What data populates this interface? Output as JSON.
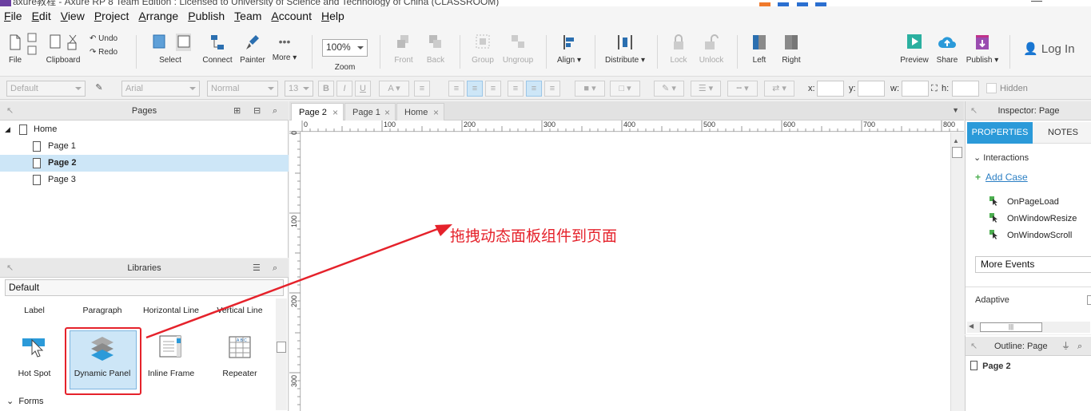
{
  "window": {
    "title": "axure教程 - Axure RP 8 Team Edition : Licensed to University of Science and Technology of China (CLASSROOM)",
    "window_controls": "—"
  },
  "menu": [
    "File",
    "Edit",
    "View",
    "Project",
    "Arrange",
    "Publish",
    "Team",
    "Account",
    "Help"
  ],
  "toolbar": {
    "file": "File",
    "clipboard": "Clipboard",
    "undo": "Undo",
    "redo": "Redo",
    "select": "Select",
    "connect": "Connect",
    "painter": "Painter",
    "more": "More ▾",
    "zoom_value": "100%",
    "zoom": "Zoom",
    "front": "Front",
    "back": "Back",
    "group": "Group",
    "ungroup": "Ungroup",
    "align": "Align ▾",
    "distribute": "Distribute ▾",
    "lock": "Lock",
    "unlock": "Unlock",
    "left": "Left",
    "right": "Right",
    "preview": "Preview",
    "share": "Share",
    "publish": "Publish ▾",
    "login": "Log In"
  },
  "format": {
    "style": "Default",
    "font": "Arial",
    "weight": "Normal",
    "size": "13",
    "bold": "B",
    "italic": "I",
    "underline": "U",
    "x_label": "x:",
    "y_label": "y:",
    "w_label": "w:",
    "h_label": "h:",
    "hidden": "Hidden"
  },
  "pages": {
    "title": "Pages",
    "items": [
      {
        "label": "Home"
      },
      {
        "label": "Page 1"
      },
      {
        "label": "Page 2"
      },
      {
        "label": "Page 3"
      }
    ]
  },
  "libraries": {
    "title": "Libraries",
    "selected": "Default",
    "row1": [
      "Label",
      "Paragraph",
      "Horizontal Line",
      "Vertical Line"
    ],
    "widgets": [
      "Hot Spot",
      "Dynamic Panel",
      "Inline Frame",
      "Repeater"
    ],
    "section": "Forms"
  },
  "tabs": [
    {
      "label": "Page 2"
    },
    {
      "label": "Page 1"
    },
    {
      "label": "Home"
    }
  ],
  "ruler": {
    "top": [
      "0",
      "100",
      "200",
      "300",
      "400",
      "500",
      "600",
      "700",
      "800"
    ],
    "left": [
      "0",
      "100",
      "200",
      "300"
    ]
  },
  "annotation": "拖拽动态面板组件到页面",
  "inspector": {
    "title": "Inspector: Page",
    "tab_properties": "PROPERTIES",
    "tab_notes": "NOTES",
    "interactions": "Interactions",
    "add_case": "Add Case",
    "events": [
      "OnPageLoad",
      "OnWindowResize",
      "OnWindowScroll"
    ],
    "more_events": "More Events",
    "adaptive": "Adaptive"
  },
  "outline": {
    "title": "Outline: Page",
    "page": "Page 2"
  },
  "colors": {
    "accent": "#2b9ad9",
    "selection": "#cde6f7",
    "annotation": "#e5222b"
  }
}
